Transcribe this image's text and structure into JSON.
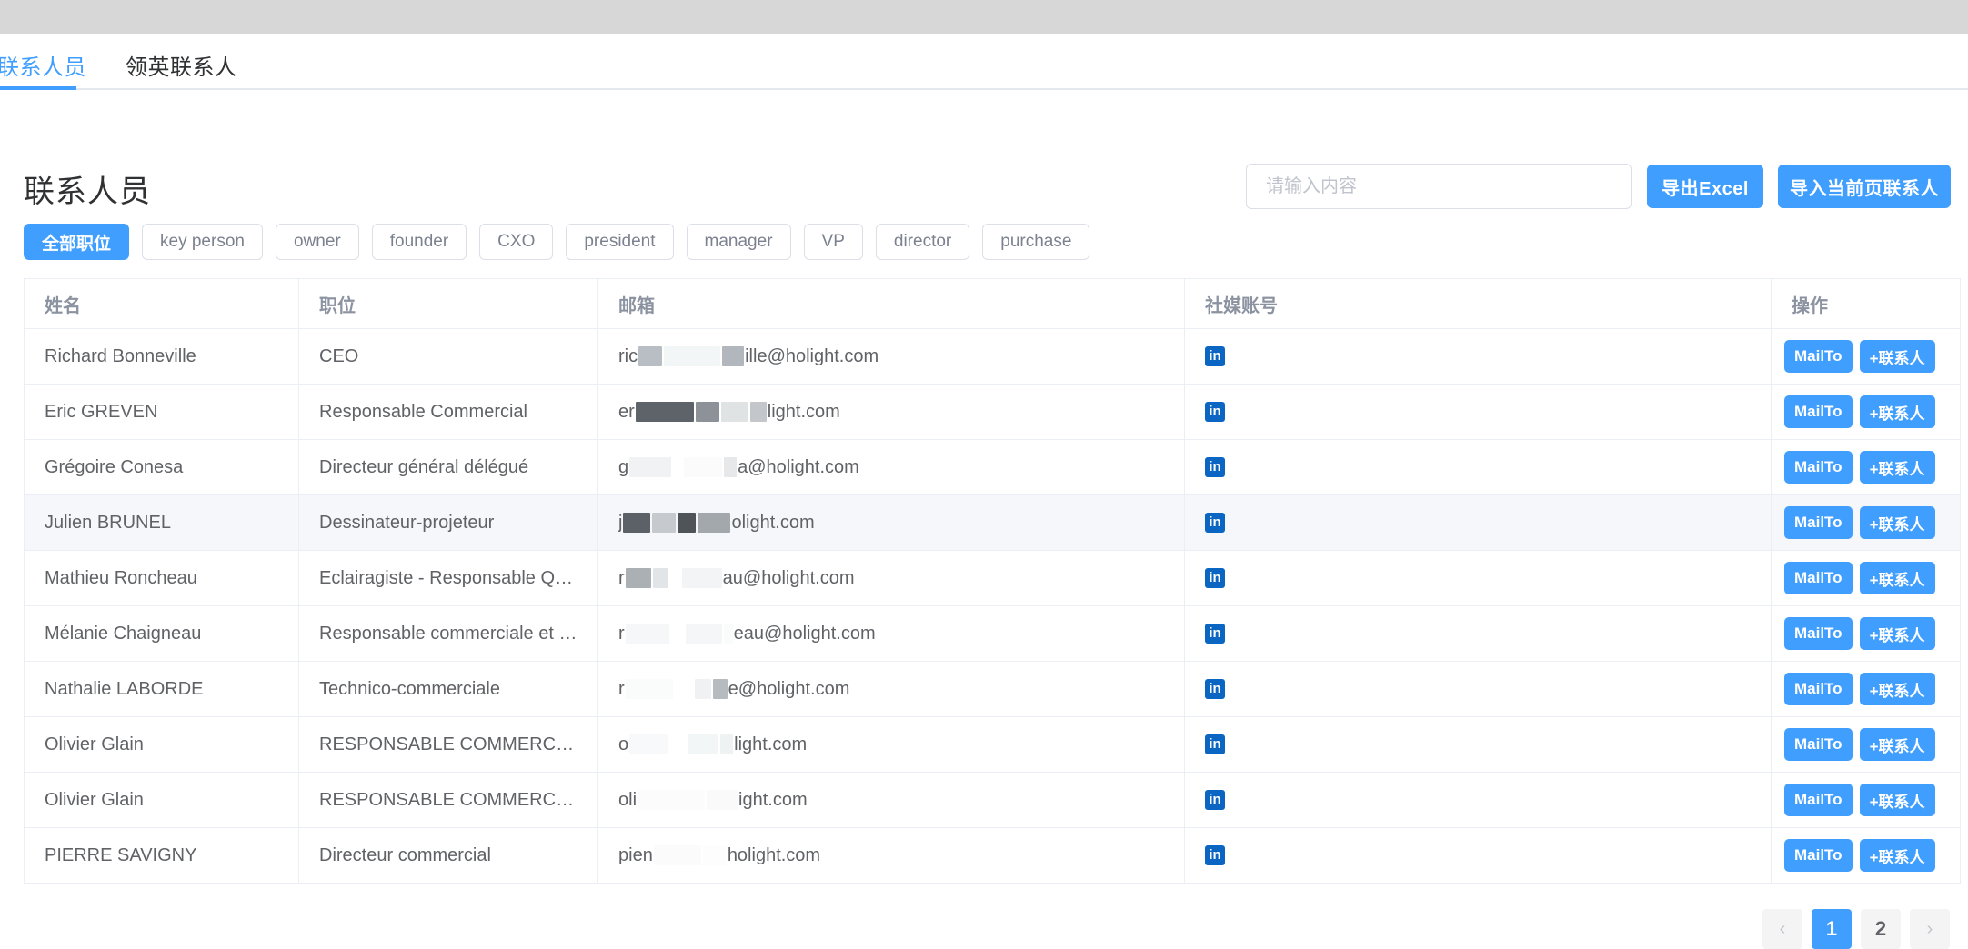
{
  "topbar": {
    "present": true,
    "color": "#d7d7d7"
  },
  "tabs": [
    {
      "label": "联系人员",
      "active": true
    },
    {
      "label": "领英联系人",
      "active": false
    }
  ],
  "page": {
    "title": "联系人员"
  },
  "search": {
    "placeholder": "请输入内容",
    "value": ""
  },
  "toolbar": {
    "export_label": "导出Excel",
    "import_label": "导入当前页联系人"
  },
  "filters": [
    {
      "label": "全部职位",
      "active": true
    },
    {
      "label": "key person",
      "active": false
    },
    {
      "label": "owner",
      "active": false
    },
    {
      "label": "founder",
      "active": false
    },
    {
      "label": "CXO",
      "active": false
    },
    {
      "label": "president",
      "active": false
    },
    {
      "label": "manager",
      "active": false
    },
    {
      "label": "VP",
      "active": false
    },
    {
      "label": "director",
      "active": false
    },
    {
      "label": "purchase",
      "active": false
    }
  ],
  "table": {
    "columns": [
      "姓名",
      "职位",
      "邮箱",
      "社媒账号",
      "操作"
    ],
    "rows": [
      {
        "name": "Richard Bonneville",
        "title": "CEO",
        "email_prefix": "ric",
        "email_suffix": "ille@holight.com",
        "social": "linkedin-icon",
        "highlight": false
      },
      {
        "name": "Eric GREVEN",
        "title": "Responsable Commercial",
        "email_prefix": "er",
        "email_suffix": "light.com",
        "social": "linkedin-icon",
        "highlight": false
      },
      {
        "name": "Grégoire Conesa",
        "title": "Directeur général délégué",
        "email_prefix": "g",
        "email_suffix": "a@holight.com",
        "social": "linkedin-icon",
        "highlight": false
      },
      {
        "name": "Julien BRUNEL",
        "title": "Dessinateur-projeteur",
        "email_prefix": "j",
        "email_suffix": "olight.com",
        "social": "linkedin-icon",
        "highlight": true
      },
      {
        "name": "Mathieu Roncheau",
        "title": "Eclairagiste - Responsable QSE",
        "email_prefix": "r",
        "email_suffix": "au@holight.com",
        "social": "linkedin-icon",
        "highlight": false
      },
      {
        "name": "Mélanie Chaigneau",
        "title": "Responsable commerciale et mark…",
        "email_prefix": "r",
        "email_suffix": "eau@holight.com",
        "social": "linkedin-icon",
        "highlight": false
      },
      {
        "name": "Nathalie LABORDE",
        "title": "Technico-commerciale",
        "email_prefix": "r",
        "email_suffix": "e@holight.com",
        "social": "linkedin-icon",
        "highlight": false
      },
      {
        "name": "Olivier Glain",
        "title": "RESPONSABLE COMMERCIAL E…",
        "email_prefix": "o",
        "email_suffix": "light.com",
        "social": "linkedin-icon",
        "highlight": false
      },
      {
        "name": "Olivier Glain",
        "title": "RESPONSABLE COMMERCIAL E…",
        "email_prefix": "oli",
        "email_suffix": "ight.com",
        "social": "linkedin-icon",
        "highlight": false
      },
      {
        "name": "PIERRE SAVIGNY",
        "title": "Directeur commercial",
        "email_prefix": "pien",
        "email_suffix": "holight.com",
        "social": "linkedin-icon",
        "highlight": false
      }
    ],
    "row_actions": {
      "mailto_label": "MailTo",
      "add_contact_label": "+联系人"
    },
    "social_icon_label": "in"
  },
  "pagination": {
    "prev": "‹",
    "next": "›",
    "pages": [
      "1",
      "2"
    ],
    "current": "1"
  },
  "colors": {
    "accent": "#409eff",
    "topbar": "#d7d7d7",
    "linkedin": "#0a66c2",
    "row_highlight": "#f5f7fa",
    "border": "#ebeef5"
  }
}
